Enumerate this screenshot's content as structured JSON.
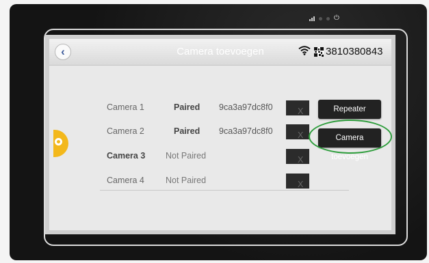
{
  "header": {
    "back_glyph": "‹",
    "title": "Camera toevoegen",
    "device_id": "3810380843",
    "wifi_icon": "wifi-icon",
    "qr_icon": "qr-code-icon"
  },
  "cameras": [
    {
      "name": "Camera 1",
      "status": "Paired",
      "id": "9ca3a97dc8f0",
      "remove": "X",
      "remove_color": "#e23030"
    },
    {
      "name": "Camera 2",
      "status": "Paired",
      "id": "9ca3a97dc8f0",
      "remove": "X",
      "remove_color": "#e23030"
    },
    {
      "name": "Camera 3",
      "status": "Not Paired",
      "id": "",
      "remove": "X",
      "remove_color": "#ffffff"
    },
    {
      "name": "Camera 4",
      "status": "Not Paired",
      "id": "",
      "remove": "X",
      "remove_color": "#ffffff"
    }
  ],
  "actions": {
    "repeater": "Repeater",
    "add_camera": "Camera toevoegen"
  },
  "colors": {
    "highlight": "#2d9d3b",
    "side_tab": "#f3b81b"
  }
}
